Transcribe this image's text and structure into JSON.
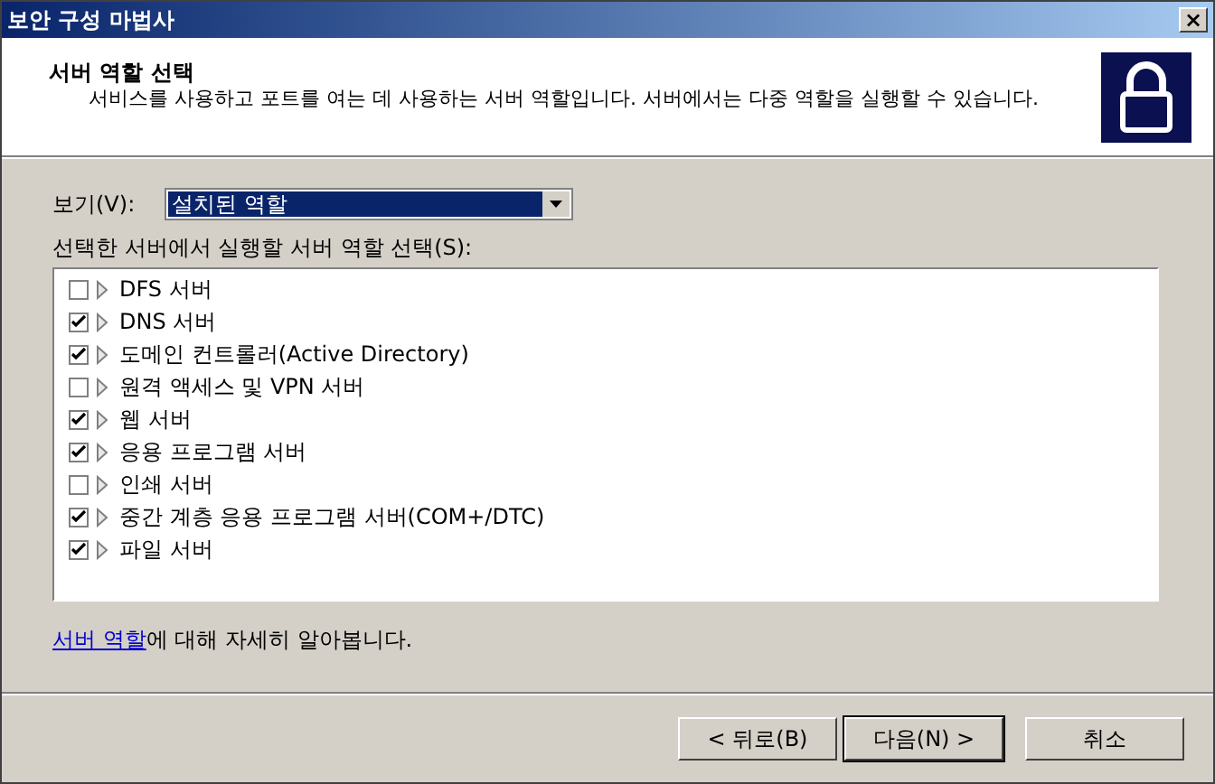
{
  "window": {
    "title": "보안 구성 마법사",
    "close": "×"
  },
  "header": {
    "title": "서버 역할 선택",
    "description": "서비스를 사용하고 포트를 여는 데 사용하는 서버 역할입니다. 서버에서는 다중 역할을 실행할 수 있습니다."
  },
  "view": {
    "label": "보기(V):",
    "value": "설치된 역할"
  },
  "list_label": "선택한 서버에서 실행할 서버 역할 선택(S):",
  "roles": [
    {
      "name": "DFS 서버",
      "checked": false
    },
    {
      "name": "DNS 서버",
      "checked": true
    },
    {
      "name": "도메인 컨트롤러(Active Directory)",
      "checked": true
    },
    {
      "name": "원격 액세스 및 VPN 서버",
      "checked": false
    },
    {
      "name": "웹 서버",
      "checked": true
    },
    {
      "name": "응용 프로그램 서버",
      "checked": true
    },
    {
      "name": "인쇄 서버",
      "checked": false
    },
    {
      "name": "중간 계층 응용 프로그램 서버(COM+/DTC)",
      "checked": true
    },
    {
      "name": "파일 서버",
      "checked": true
    }
  ],
  "info": {
    "link": "서버 역할",
    "text": "에 대해 자세히 알아봅니다."
  },
  "buttons": [
    {
      "label": "< 뒤로(B)",
      "default": false
    },
    {
      "label": "다음(N) >",
      "default": true
    },
    {
      "label": "취소",
      "default": false
    }
  ]
}
